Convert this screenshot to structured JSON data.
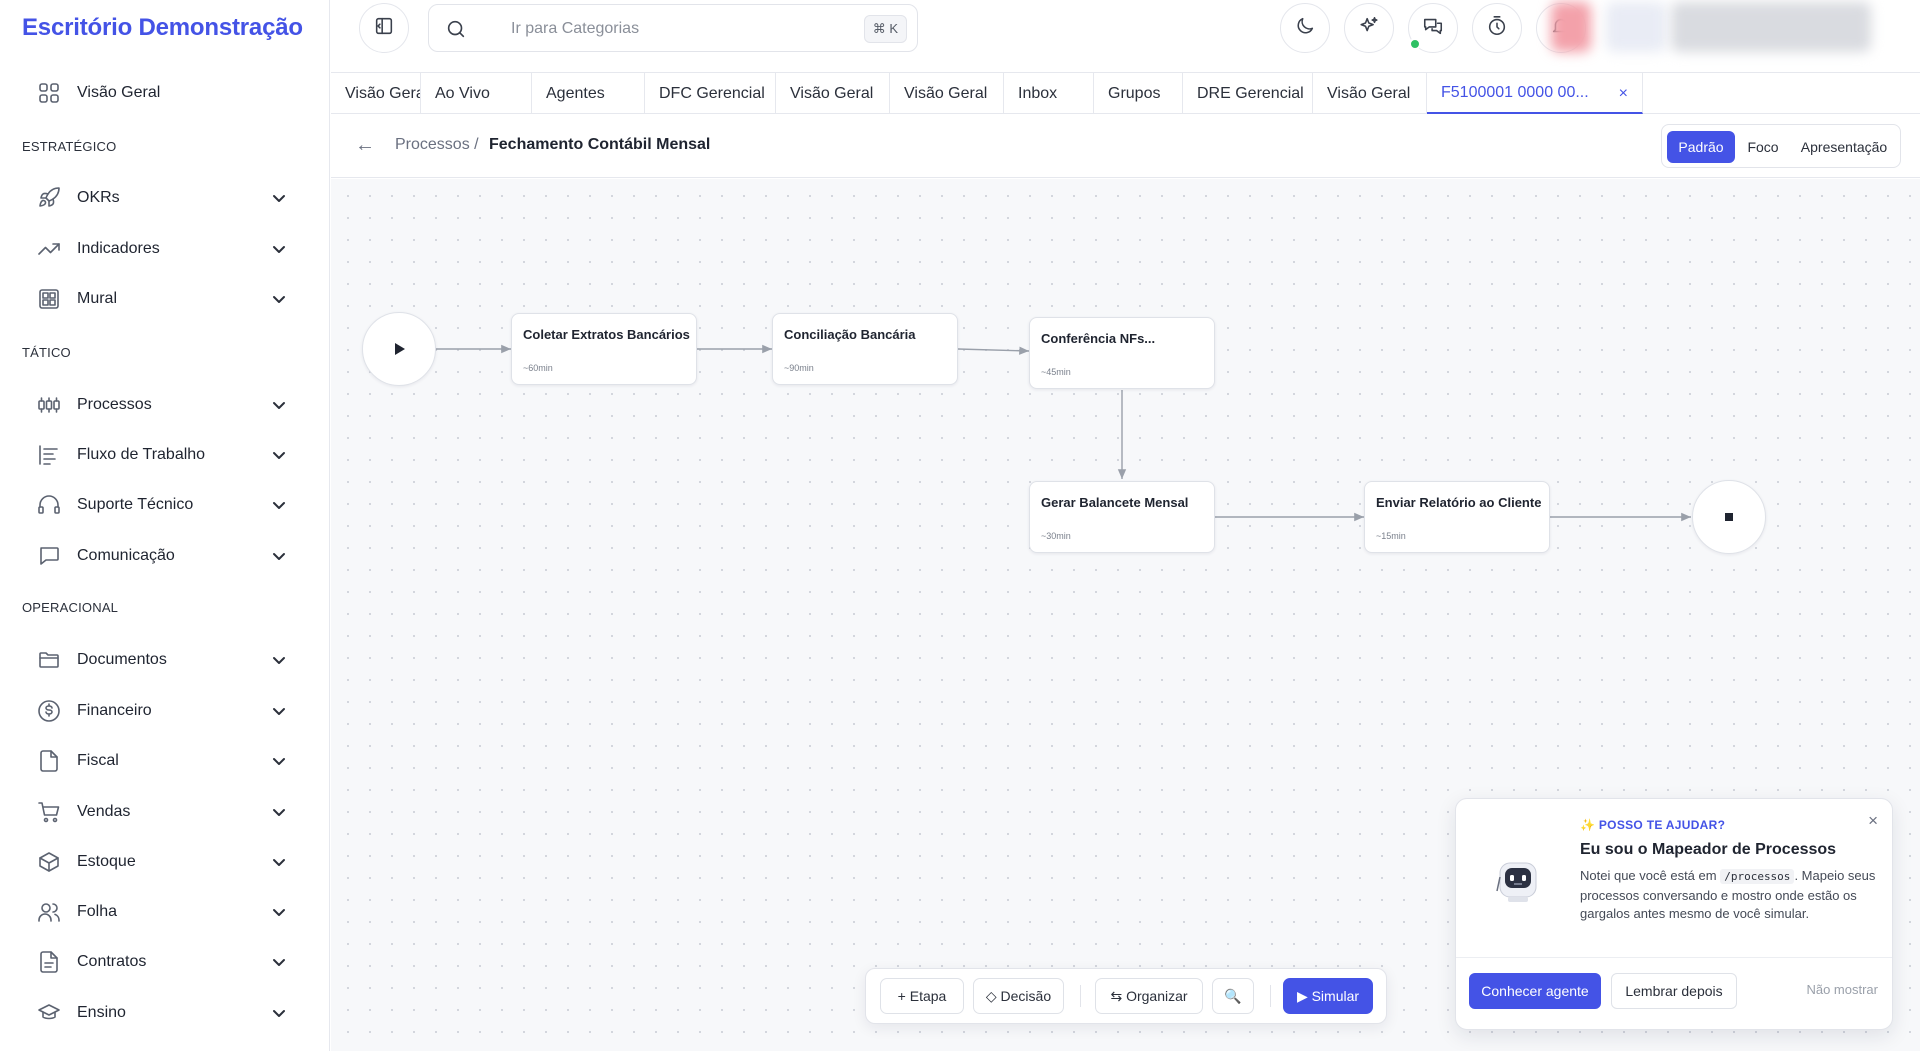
{
  "app": {
    "brand": "Escritório Demonstração",
    "accent_color": "#4453e6"
  },
  "sidebar": {
    "overview": {
      "label": "Visão Geral",
      "icon": "grid-icon"
    },
    "sections": [
      {
        "title": "ESTRATÉGICO",
        "items": [
          {
            "label": "OKRs",
            "icon": "rocket-icon"
          },
          {
            "label": "Indicadores",
            "icon": "trending-up-icon"
          },
          {
            "label": "Mural",
            "icon": "board-icon"
          }
        ]
      },
      {
        "title": "TÁTICO",
        "items": [
          {
            "label": "Processos",
            "icon": "process-icon"
          },
          {
            "label": "Fluxo de Trabalho",
            "icon": "workflow-icon"
          },
          {
            "label": "Suporte Técnico",
            "icon": "headset-icon"
          },
          {
            "label": "Comunicação",
            "icon": "chat-icon"
          }
        ]
      },
      {
        "title": "OPERACIONAL",
        "items": [
          {
            "label": "Documentos",
            "icon": "folder-icon"
          },
          {
            "label": "Financeiro",
            "icon": "dollar-icon"
          },
          {
            "label": "Fiscal",
            "icon": "file-icon"
          },
          {
            "label": "Vendas",
            "icon": "cart-icon"
          },
          {
            "label": "Estoque",
            "icon": "box-icon"
          },
          {
            "label": "Folha",
            "icon": "users-icon"
          },
          {
            "label": "Contratos",
            "icon": "contract-icon"
          },
          {
            "label": "Ensino",
            "icon": "graduation-icon"
          }
        ]
      }
    ]
  },
  "topbar": {
    "search": {
      "placeholder": "Ir para Categorias",
      "shortcut": "⌘ K"
    },
    "status_color": "#2fc164"
  },
  "tabs": [
    {
      "label": "Visão Geral"
    },
    {
      "label": "Ao Vivo"
    },
    {
      "label": "Agentes"
    },
    {
      "label": "DFC Gerencial"
    },
    {
      "label": "Visão Geral"
    },
    {
      "label": "Visão Geral"
    },
    {
      "label": "Inbox"
    },
    {
      "label": "Grupos"
    },
    {
      "label": "DRE Gerencial"
    },
    {
      "label": "Visão Geral"
    },
    {
      "label": "F5100001 0000 00...",
      "active": true,
      "close": "×"
    }
  ],
  "breadcrumb": {
    "back": "←",
    "parent": "Processos /",
    "current": "Fechamento Contábil Mensal"
  },
  "view_modes": [
    {
      "label": "Padrão",
      "active": true
    },
    {
      "label": "Foco"
    },
    {
      "label": "Apresentação"
    }
  ],
  "flow": {
    "nodes": [
      {
        "title": "Coletar Extratos Bancários",
        "duration": "~60min"
      },
      {
        "title": "Conciliação Bancária",
        "duration": "~90min"
      },
      {
        "title": "Conferência NFs...",
        "duration": "~45min"
      },
      {
        "title": "Gerar Balancete Mensal",
        "duration": "~30min"
      },
      {
        "title": "Enviar Relatório ao Cliente",
        "duration": "~15min"
      }
    ]
  },
  "toolbar": {
    "add_step": "+ Etapa",
    "decision": "◇ Decisão",
    "organize": "⇆ Organizar",
    "zoom": "🔍",
    "simulate": "▶ Simular"
  },
  "agent_card": {
    "kicker": "✨ POSSO TE AJUDAR?",
    "title": "Eu sou o Mapeador de Processos",
    "body_before": "Notei que você está em ",
    "body_code": "/processos",
    "body_after": ". Mapeio seus processos conversando e mostro onde estão os gargalos antes mesmo de você simular.",
    "primary": "Conhecer agente",
    "secondary": "Lembrar depois",
    "dismiss": "Não mostrar",
    "close": "×"
  }
}
